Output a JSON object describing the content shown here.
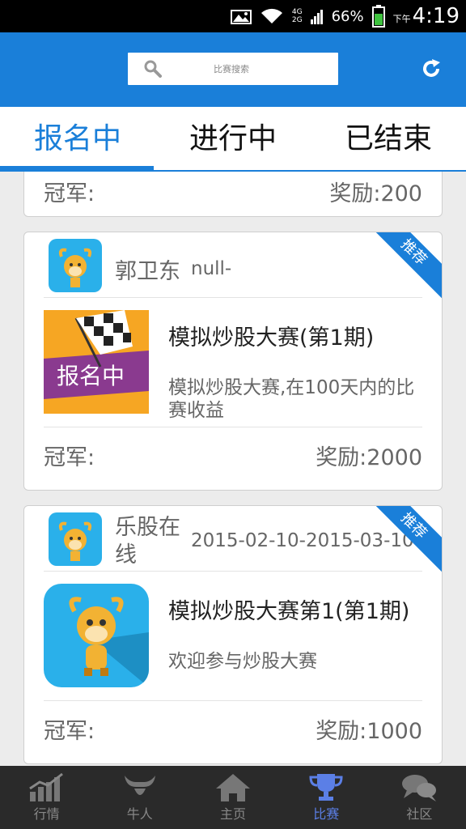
{
  "status_bar": {
    "network_top": "4G",
    "network_bottom": "2G",
    "battery": "66%",
    "ampm": "下午",
    "time": "4:19"
  },
  "header": {
    "search_placeholder": "比赛搜索",
    "search_icon": "search-icon",
    "refresh_icon": "refresh-icon"
  },
  "tabs": [
    {
      "label": "报名中",
      "active": true
    },
    {
      "label": "进行中",
      "active": false
    },
    {
      "label": "已结束",
      "active": false
    }
  ],
  "cards": [
    {
      "champion_label": "冠军:",
      "reward": "奖励:200"
    },
    {
      "org_name": "郭卫东",
      "org_date": "null-",
      "badge": "推荐",
      "thumb_text": "报名中",
      "title": "模拟炒股大赛(第1期)",
      "desc": "模拟炒股大赛,在100天内的比赛收益",
      "champion_label": "冠军:",
      "reward": "奖励:2000"
    },
    {
      "org_name": "乐股在线",
      "org_date": "2015-02-10-2015-03-10",
      "badge": "推荐",
      "title": "模拟炒股大赛第1(第1期)",
      "desc": "欢迎参与炒股大赛",
      "champion_label": "冠军:",
      "reward": "奖励:1000"
    }
  ],
  "bottom_nav": [
    {
      "label": "行情",
      "icon": "chart-icon",
      "active": false
    },
    {
      "label": "牛人",
      "icon": "bull-icon",
      "active": false
    },
    {
      "label": "主页",
      "icon": "home-icon",
      "active": false
    },
    {
      "label": "比赛",
      "icon": "trophy-icon",
      "active": true
    },
    {
      "label": "社区",
      "icon": "chat-icon",
      "active": false
    }
  ],
  "colors": {
    "accent": "#1a7fd9",
    "active_nav": "#5b7fe6",
    "nav_bg": "#2a2a2a"
  }
}
